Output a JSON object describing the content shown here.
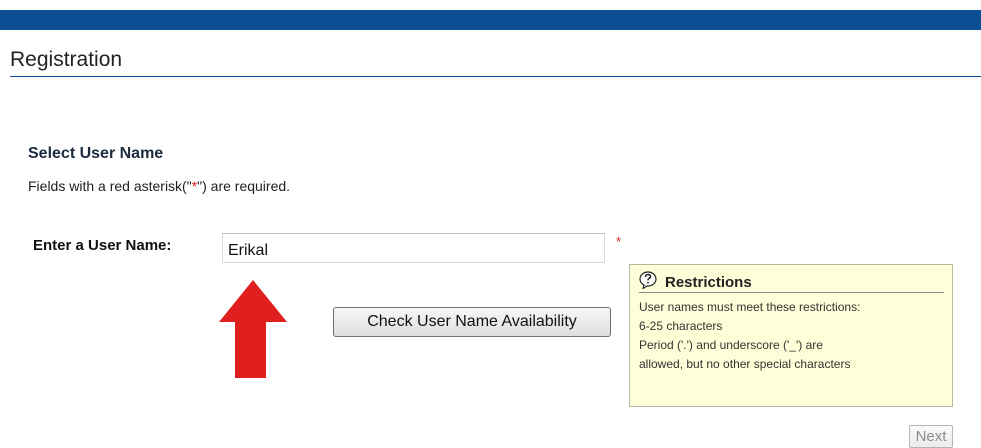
{
  "page": {
    "title": "Registration"
  },
  "section": {
    "heading": "Select User Name",
    "required_note_prefix": "Fields with a red asterisk(\"",
    "required_note_star": "*",
    "required_note_suffix": "\") are required."
  },
  "form": {
    "username_label": "Enter a User Name:",
    "username_value": "Erikal",
    "required_marker": "*",
    "check_button_label": "Check User Name Availability",
    "next_button_label": "Next"
  },
  "restrictions": {
    "icon": "question-bubble-icon",
    "title": "Restrictions",
    "lines": [
      "User names must meet these restrictions:",
      "6-25 characters",
      "Period ('.') and underscore ('_') are",
      "allowed, but no other special characters"
    ]
  },
  "colors": {
    "header_bar": "#0a4f94",
    "required_red": "#e0201e",
    "annotation_arrow": "#e0201e",
    "tooltip_background": "#fefed8"
  }
}
